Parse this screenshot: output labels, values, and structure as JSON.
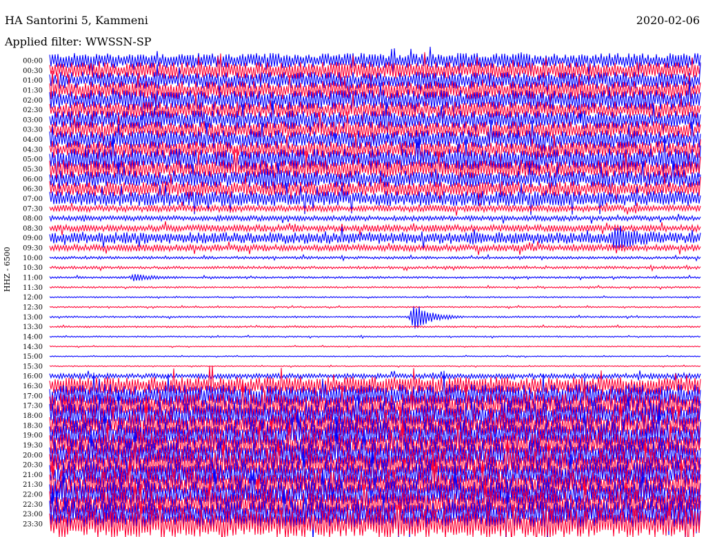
{
  "header": {
    "station": "HA Santorini 5, Kammeni",
    "date": "2020-02-06",
    "filter": "Applied filter: WWSSN-SP"
  },
  "channel_label": "HHZ - 6500",
  "colors": {
    "odd": "#0000ff",
    "even": "#ff0033"
  },
  "chart_data": {
    "type": "line",
    "title": "HA Santorini 5, Kammeni",
    "ylabel": "HHZ - 6500",
    "row_labels": [
      "00:00",
      "00:30",
      "01:00",
      "01:30",
      "02:00",
      "02:30",
      "03:00",
      "03:30",
      "04:00",
      "04:30",
      "05:00",
      "05:30",
      "06:00",
      "06:30",
      "07:00",
      "07:30",
      "08:00",
      "08:30",
      "09:00",
      "09:30",
      "10:00",
      "10:30",
      "11:00",
      "11:30",
      "12:00",
      "12:30",
      "13:00",
      "13:30",
      "14:00",
      "14:30",
      "15:00",
      "15:30",
      "16:00",
      "16:30",
      "17:00",
      "17:30",
      "18:00",
      "18:30",
      "19:00",
      "19:30",
      "20:00",
      "20:30",
      "21:00",
      "21:30",
      "22:00",
      "22:30",
      "23:00",
      "23:30"
    ],
    "row_noise_level": [
      0.45,
      0.5,
      0.5,
      0.55,
      0.6,
      0.5,
      0.55,
      0.5,
      0.55,
      0.5,
      0.65,
      0.55,
      0.5,
      0.45,
      0.45,
      0.2,
      0.15,
      0.2,
      0.35,
      0.2,
      0.08,
      0.08,
      0.06,
      0.05,
      0.04,
      0.04,
      0.05,
      0.05,
      0.04,
      0.03,
      0.03,
      0.03,
      0.15,
      0.55,
      0.7,
      0.75,
      0.8,
      0.75,
      0.8,
      0.8,
      0.8,
      0.8,
      0.8,
      0.8,
      0.8,
      0.8,
      0.8,
      0.85
    ],
    "events": [
      {
        "row": "13:00",
        "position": 0.56,
        "amplitude": 1.4
      },
      {
        "row": "09:00",
        "position": 0.87,
        "amplitude": 0.9
      },
      {
        "row": "06:00",
        "position": 0.33,
        "amplitude": 0.7
      },
      {
        "row": "11:00",
        "position": 0.13,
        "amplitude": 0.35
      }
    ]
  }
}
